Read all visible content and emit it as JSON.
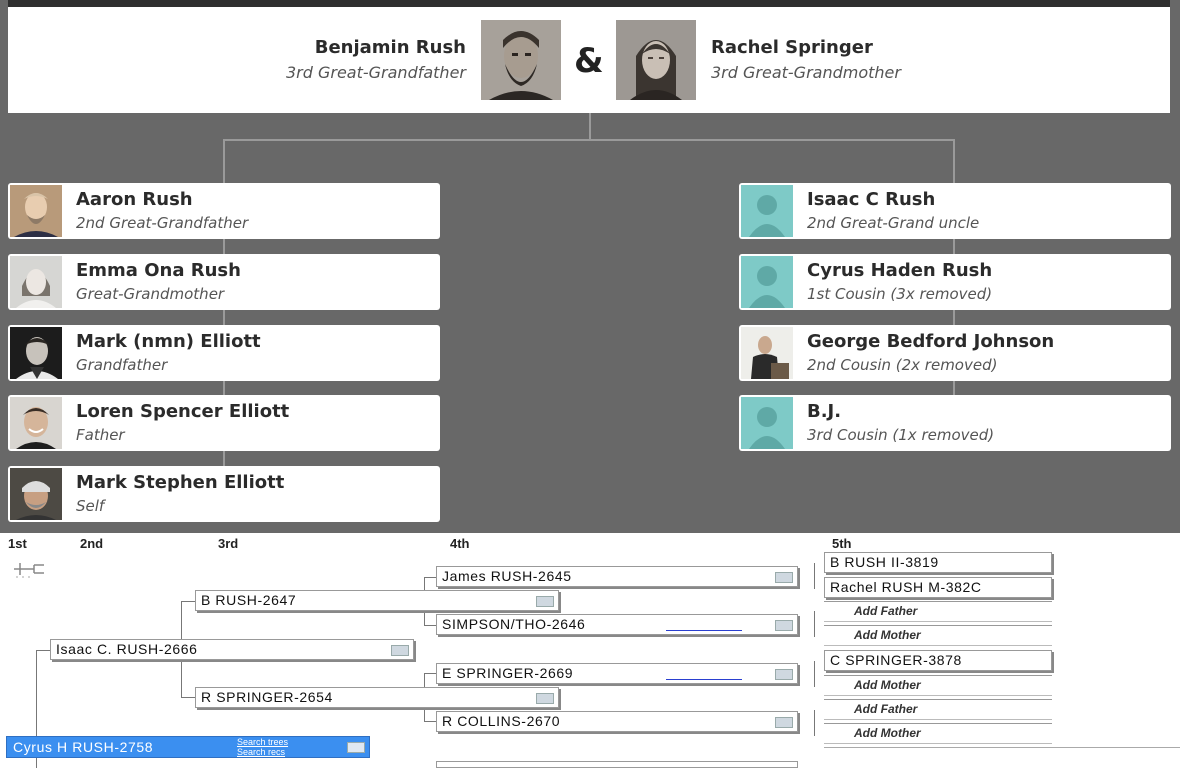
{
  "couple": {
    "person1": {
      "name": "Benjamin Rush",
      "relation": "3rd Great-Grandfather"
    },
    "ampersand": "&",
    "person2": {
      "name": "Rachel Springer",
      "relation": "3rd Great-Grandmother"
    }
  },
  "left_line": [
    {
      "name": "Aaron Rush",
      "relation": "2nd Great-Grandfather"
    },
    {
      "name": "Emma Ona Rush",
      "relation": "Great-Grandmother"
    },
    {
      "name": "Mark (nmn) Elliott",
      "relation": "Grandfather"
    },
    {
      "name": "Loren Spencer Elliott",
      "relation": "Father"
    },
    {
      "name": "Mark Stephen Elliott",
      "relation": "Self"
    }
  ],
  "right_line": [
    {
      "name": "Isaac C Rush",
      "relation": "2nd Great-Grand uncle"
    },
    {
      "name": "Cyrus Haden Rush",
      "relation": "1st Cousin (3x removed)"
    },
    {
      "name": "George Bedford Johnson",
      "relation": "2nd Cousin (2x removed)"
    },
    {
      "name": "B.J.",
      "relation": "3rd Cousin (1x removed)"
    }
  ],
  "pedigree": {
    "generations": [
      "1st",
      "2nd",
      "3rd",
      "4th",
      "5th"
    ],
    "root": {
      "name": "Cyrus H RUSH-2758",
      "link1": "Search trees",
      "link2": "Search recs"
    },
    "gen2": [
      "Isaac C. RUSH-2666"
    ],
    "gen3": [
      "B RUSH-2647",
      "R SPRINGER-2654"
    ],
    "gen4": [
      "James RUSH-2645",
      "SIMPSON/THO-2646",
      "E SPRINGER-2669",
      "R COLLINS-2670"
    ],
    "gen5": [
      "B RUSH II-3819",
      "Rachel RUSH M-382C",
      "Add Father",
      "Add Mother",
      "C SPRINGER-3878",
      "Add Mother",
      "Add Father",
      "Add Mother"
    ]
  },
  "colors": {
    "panel_bg": "#686868",
    "placeholder_avatar": "#7ecac7",
    "selected_row": "#3b8ff0"
  }
}
